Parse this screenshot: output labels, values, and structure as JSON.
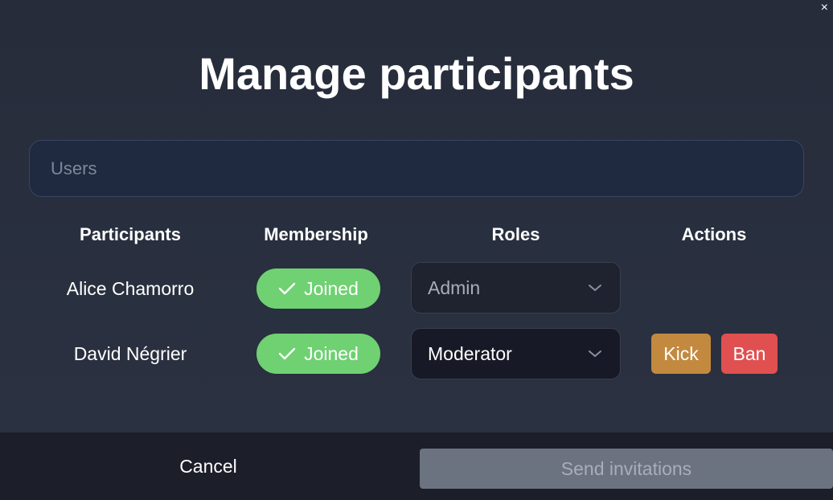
{
  "dialog": {
    "title": "Manage participants",
    "close_glyph": "×"
  },
  "search": {
    "placeholder": "Users",
    "value": ""
  },
  "table": {
    "headers": [
      "Participants",
      "Membership",
      "Roles",
      "Actions"
    ],
    "rows": [
      {
        "name": "Alice Chamorro",
        "membership": "Joined",
        "membership_icon": "check-icon",
        "role": "Admin",
        "role_editable": false,
        "actions": []
      },
      {
        "name": "David Négrier",
        "membership": "Joined",
        "membership_icon": "check-icon",
        "role": "Moderator",
        "role_editable": true,
        "actions": [
          "Kick",
          "Ban"
        ]
      }
    ]
  },
  "footer": {
    "cancel_label": "Cancel",
    "send_label": "Send invitations",
    "send_enabled": false
  },
  "colors": {
    "joined_badge": "#6fd172",
    "kick": "#c38a3f",
    "ban": "#e05050",
    "send_disabled": "#6b7280"
  }
}
